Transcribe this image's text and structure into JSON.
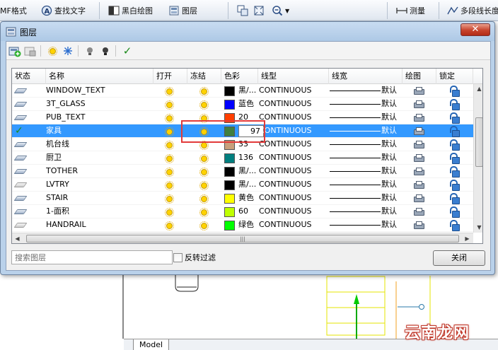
{
  "toolbar": {
    "items": [
      "MF格式",
      "查找文字",
      "黑白绘图",
      "图层",
      "测量",
      "多段线长度"
    ]
  },
  "dialog": {
    "title": "图层",
    "close_symbol": "✕",
    "columns": [
      "状态",
      "名称",
      "打开",
      "冻结",
      "色彩",
      "线型",
      "线宽",
      "绘图",
      "锁定"
    ],
    "rows": [
      {
        "name": "WINDOW_TEXT",
        "color_label": "黑/...",
        "color_hex": "#000000",
        "linetype": "CONTINUOUS",
        "lineweight": "默认",
        "current": false
      },
      {
        "name": "3T_GLASS",
        "color_label": "蓝色",
        "color_hex": "#0000ff",
        "linetype": "CONTINUOUS",
        "lineweight": "默认",
        "current": false
      },
      {
        "name": "PUB_TEXT",
        "color_label": "20",
        "color_hex": "#ff3f00",
        "linetype": "CONTINUOUS",
        "lineweight": "默认",
        "current": false
      },
      {
        "name": "家具",
        "color_label": "97",
        "color_hex": "#3f7f3f",
        "linetype": "CONTINUOUS",
        "lineweight": "默认",
        "current": true
      },
      {
        "name": "机台线",
        "color_label": "33",
        "color_hex": "#c8a07c",
        "linetype": "CONTINUOUS",
        "lineweight": "默认",
        "current": false
      },
      {
        "name": "厨卫",
        "color_label": "136",
        "color_hex": "#007f7f",
        "linetype": "CONTINUOUS",
        "lineweight": "默认",
        "current": false
      },
      {
        "name": "TOTHER",
        "color_label": "黑/...",
        "color_hex": "#000000",
        "linetype": "CONTINUOUS",
        "lineweight": "默认",
        "current": false
      },
      {
        "name": "LVTRY",
        "color_label": "黑/...",
        "color_hex": "#000000",
        "linetype": "CONTINUOUS",
        "lineweight": "默认",
        "current": false
      },
      {
        "name": "STAIR",
        "color_label": "黄色",
        "color_hex": "#ffff00",
        "linetype": "CONTINUOUS",
        "lineweight": "默认",
        "current": false
      },
      {
        "name": "1-面积",
        "color_label": "60",
        "color_hex": "#bfff00",
        "linetype": "CONTINUOUS",
        "lineweight": "默认",
        "current": false
      },
      {
        "name": "HANDRAIL",
        "color_label": "绿色",
        "color_hex": "#00ff00",
        "linetype": "CONTINUOUS",
        "lineweight": "默认",
        "current": false
      }
    ],
    "search_placeholder": "搜索图层",
    "invert_filter_label": "反转过滤",
    "close_button": "关闭"
  },
  "canvas": {
    "model_tab": "Model",
    "watermark": "云南龙网"
  },
  "colors": {
    "selection": "#3399ff",
    "highlight_box": "#e23a3a"
  }
}
